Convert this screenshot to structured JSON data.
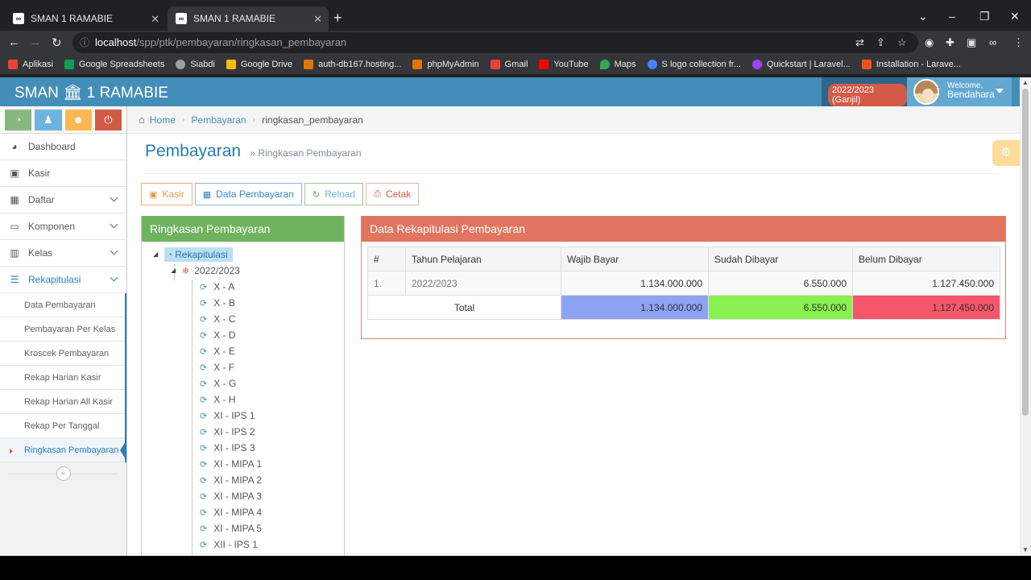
{
  "browser": {
    "tabs": [
      {
        "title": "SMAN 1 RAMABIE"
      },
      {
        "title": "SMAN 1 RAMABIE"
      }
    ],
    "url_host": "localhost",
    "url_path": "/spp/ptk/pembayaran/ringkasan_pembayaran",
    "bookmarks": [
      {
        "label": "Aplikasi",
        "icon": "apps-grid-icon",
        "color": "#ea4335"
      },
      {
        "label": "Google Spreadsheets",
        "icon": "sheets-icon",
        "color": "#0f9d58"
      },
      {
        "label": "Siabdi",
        "icon": "globe-icon",
        "color": "#9aa0a6"
      },
      {
        "label": "Google Drive",
        "icon": "drive-icon",
        "color": "#fbbc04"
      },
      {
        "label": "auth-db167.hosting...",
        "icon": "hosting-icon",
        "color": "#e37400"
      },
      {
        "label": "phpMyAdmin",
        "icon": "phpmyadmin-icon",
        "color": "#e37400"
      },
      {
        "label": "Gmail",
        "icon": "gmail-icon",
        "color": "#ea4335"
      },
      {
        "label": "YouTube",
        "icon": "youtube-icon",
        "color": "#ff0000"
      },
      {
        "label": "Maps",
        "icon": "maps-icon",
        "color": "#34a853"
      },
      {
        "label": "S logo collection fr...",
        "icon": "logo-icon",
        "color": "#4285f4"
      },
      {
        "label": "Quickstart | Laravel...",
        "icon": "laravel-icon",
        "color": "#a142f4"
      },
      {
        "label": "Installation - Larave...",
        "icon": "laravel-icon",
        "color": "#f4511e"
      }
    ]
  },
  "app": {
    "brand_left": "SMAN",
    "brand_right": "1 RAMABIE",
    "school_year_badge": "2022/2023 (Ganjil)",
    "welcome": "Welcome,",
    "user_name": "Bendahara"
  },
  "sidebar": {
    "menu": [
      {
        "label": "Dashboard",
        "icon": "tachometer-icon"
      },
      {
        "label": "Kasir",
        "icon": "money-icon"
      },
      {
        "label": "Daftar",
        "icon": "table-icon"
      },
      {
        "label": "Komponen",
        "icon": "desktop-icon"
      },
      {
        "label": "Kelas",
        "icon": "building-icon"
      },
      {
        "label": "Rekapitulasi",
        "icon": "list-icon"
      }
    ],
    "submenu": [
      "Data Pembayaran",
      "Pembayaran Per Kelas",
      "Kroscek Pembayaran",
      "Rekap Harian Kasir",
      "Rekap Harian All Kasir",
      "Rekap Per Tanggal",
      "Ringkasan Pembayaran"
    ]
  },
  "breadcrumb": {
    "home": "Home",
    "section": "Pembayaran",
    "current": "ringkasan_pembayaran"
  },
  "header": {
    "title": "Pembayaran",
    "subtitle": "» Ringkasan Pembayaran"
  },
  "actions": {
    "kasir": "Kasir",
    "data_pembayaran": "Data Pembayaran",
    "reload": "Reload",
    "cetak": "Cetak"
  },
  "tree": {
    "title": "Ringkasan Pembayaran",
    "root": "Rekapitulasi",
    "year": "2022/2023",
    "classes": [
      "X - A",
      "X - B",
      "X - C",
      "X - D",
      "X - E",
      "X - F",
      "X - G",
      "X - H",
      "XI - IPS 1",
      "XI - IPS 2",
      "XI - IPS 3",
      "XI - MIPA 1",
      "XI - MIPA 2",
      "XI - MIPA 3",
      "XI - MIPA 4",
      "XI - MIPA 5",
      "XII - IPS 1"
    ]
  },
  "rekap": {
    "title": "Data Rekapitulasi Pembayaran",
    "columns": [
      "#",
      "Tahun Pelajaran",
      "Wajib Bayar",
      "Sudah Dibayar",
      "Belum Dibayar"
    ],
    "rows": [
      {
        "no": "1.",
        "tahun": "2022/2023",
        "wajib": "1.134.000.000",
        "sudah": "6.550.000",
        "belum": "1.127.450.000"
      }
    ],
    "total": {
      "label": "Total",
      "wajib": "1.134.000.000",
      "sudah": "6.550.000",
      "belum": "1.127.450.000"
    },
    "colors": {
      "wajib": "#8fa3f5",
      "sudah": "#88f04f",
      "belum": "#f6566a"
    }
  }
}
